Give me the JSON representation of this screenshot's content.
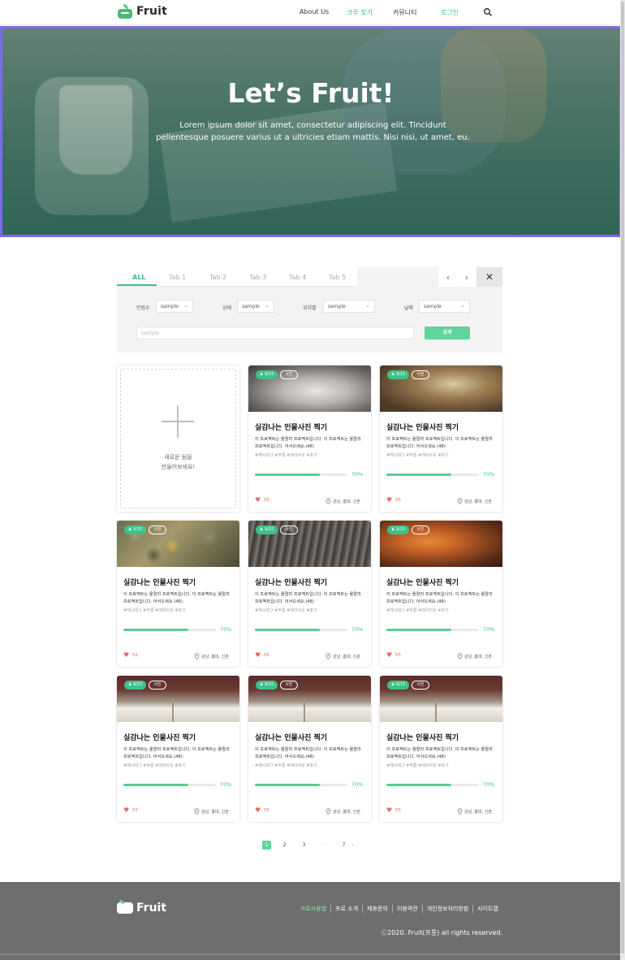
{
  "header": {
    "logo_text": "Fruit",
    "nav": [
      {
        "label": "About Us",
        "active": false
      },
      {
        "label": "크루 찾기",
        "active": true
      },
      {
        "label": "커뮤니티",
        "active": false
      },
      {
        "label": "로그인",
        "active": true
      }
    ]
  },
  "hero": {
    "title": "Let’s Fruit!",
    "subtitle": "Lorem ipsum dolor sit amet, consectetur adipiscing elit. Tincidunt pellentesque posuere varius ut a ultricies etiam mattis. Nisi nisi, ut amet, eu."
  },
  "tabs": {
    "items": [
      "ALL",
      "Tab 1",
      "Tab 2",
      "Tab 3",
      "Tab 4",
      "Tab 5"
    ],
    "active_index": 0,
    "prev_icon": "‹",
    "next_icon": "›",
    "close_icon": "✕"
  },
  "filters": {
    "fields": [
      {
        "label": "인원수",
        "value": "sample"
      },
      {
        "label": "상태",
        "value": "sample"
      },
      {
        "label": "위치별",
        "value": "sample"
      },
      {
        "label": "날짜",
        "value": "sample"
      }
    ],
    "search_placeholder": "sample",
    "search_button": "검색"
  },
  "new_team": {
    "text": "새로운 팀을\n만들어보세요!"
  },
  "cards": [
    {
      "image": "statue",
      "capacity": "9/15",
      "tag": "사진",
      "title": "실감나는 인물사진 찍기",
      "desc": "이 프로젝트는 울랄라 프로젝트입니다. 이 프로젝트는 울랄라 프로젝트입니다. 어서오세요.(48)",
      "tags": "#해시태그  #부릉  #레이아웃  #포기",
      "progress": 0.7,
      "progress_label": "70%",
      "likes": "55",
      "location": "강남, 홍대, 신촌"
    },
    {
      "image": "painting",
      "capacity": "9/15",
      "tag": "사진",
      "title": "실감나는 인물사진 찍기",
      "desc": "이 프로젝트는 울랄라 프로젝트입니다. 이 프로젝트는 울랄라 프로젝트입니다. 어서오세요.(48)",
      "tags": "#해시태그  #부릉  #레이아웃  #포기",
      "progress": 0.7,
      "progress_label": "70%",
      "likes": "55",
      "location": "강남, 홍대, 신촌"
    },
    {
      "image": "leaves",
      "capacity": "9/15",
      "tag": "사진",
      "title": "실감나는 인물사진 찍기",
      "desc": "이 프로젝트는 울랄라 프로젝트입니다. 이 프로젝트는 울랄라 프로젝트입니다. 어서오세요.(48)",
      "tags": "#해시태그  #부릉  #레이아웃  #포기",
      "progress": 0.7,
      "progress_label": "70%",
      "likes": "55",
      "location": "강남, 홍대, 신촌"
    },
    {
      "image": "wood",
      "capacity": "9/15",
      "tag": "사진",
      "title": "실감나는 인물사진 찍기",
      "desc": "이 프로젝트는 울랄라 프로젝트입니다. 이 프로젝트는 울랄라 프로젝트입니다. 어서오세요.(48)",
      "tags": "#해시태그  #부릉  #레이아웃  #포기",
      "progress": 0.7,
      "progress_label": "70%",
      "likes": "55",
      "location": "강남, 홍대, 신촌"
    },
    {
      "image": "autumn",
      "capacity": "9/15",
      "tag": "사진",
      "title": "실감나는 인물사진 찍기",
      "desc": "이 프로젝트는 울랄라 프로젝트입니다. 이 프로젝트는 울랄라 프로젝트입니다. 어서오세요.(48)",
      "tags": "#해시태그  #부릉  #레이아웃  #포기",
      "progress": 0.7,
      "progress_label": "70%",
      "likes": "55",
      "location": "강남, 홍대, 신촌"
    },
    {
      "image": "book",
      "capacity": "9/15",
      "tag": "사진",
      "title": "실감나는 인물사진 찍기",
      "desc": "이 프로젝트는 울랄라 프로젝트입니다. 이 프로젝트는 울랄라 프로젝트입니다. 어서오세요.(48)",
      "tags": "#해시태그  #부릉  #레이아웃  #포기",
      "progress": 0.7,
      "progress_label": "70%",
      "likes": "55",
      "location": "강남, 홍대, 신촌"
    },
    {
      "image": "book",
      "capacity": "9/15",
      "tag": "사진",
      "title": "실감나는 인물사진 찍기",
      "desc": "이 프로젝트는 울랄라 프로젝트입니다. 이 프로젝트는 울랄라 프로젝트입니다. 어서오세요.(48)",
      "tags": "#해시태그  #부릉  #레이아웃  #포기",
      "progress": 0.7,
      "progress_label": "70%",
      "likes": "55",
      "location": "강남, 홍대, 신촌"
    },
    {
      "image": "book",
      "capacity": "9/15",
      "tag": "사진",
      "title": "실감나는 인물사진 찍기",
      "desc": "이 프로젝트는 울랄라 프로젝트입니다. 이 프로젝트는 울랄라 프로젝트입니다. 어서오세요.(48)",
      "tags": "#해시태그  #부릉  #레이아웃  #포기",
      "progress": 0.7,
      "progress_label": "70%",
      "likes": "55",
      "location": "강남, 홍대, 신촌"
    }
  ],
  "pagination": {
    "pages": [
      "1",
      "2",
      "3",
      "···",
      "7"
    ],
    "active": "1",
    "next_icon": "›"
  },
  "footer": {
    "logo_text": "Fruit",
    "links": [
      "프로사용법",
      "프로 소개",
      "제휴문의",
      "이용약관",
      "개인정보처리방침",
      "사이트맵"
    ],
    "copyright": "ⓒ2020. Fruit(프룻) all rights reserved."
  },
  "colors": {
    "accent": "#3ec08a",
    "hero_border": "#7a6af1",
    "footer_bg": "#6e6e6e",
    "like": "#e76a6a"
  }
}
